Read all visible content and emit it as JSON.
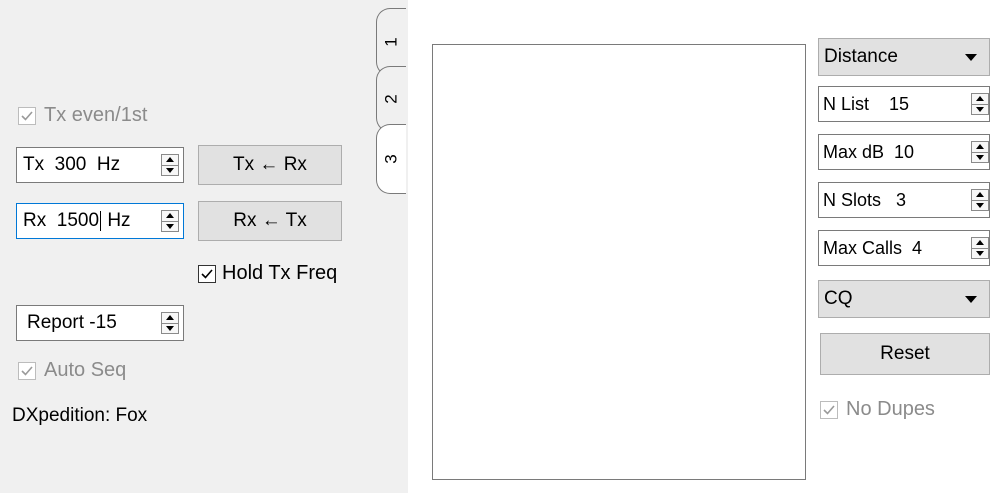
{
  "left": {
    "tx_even": {
      "label": "Tx even/1st",
      "checked": true,
      "enabled": false
    },
    "tx_freq": {
      "value": "Tx  300  Hz"
    },
    "tx_from_rx": {
      "label": "Tx ← Rx"
    },
    "rx_freq": {
      "value_before_caret": "Rx  1500",
      "value_after_caret": " Hz"
    },
    "rx_from_tx": {
      "label": "Rx ← Tx"
    },
    "hold_tx_freq": {
      "label": "Hold Tx Freq",
      "checked": true
    },
    "report": {
      "value": "Report -15"
    },
    "auto_seq": {
      "label": "Auto Seq",
      "checked": true,
      "enabled": false
    },
    "dxpedition": {
      "label": "DXpedition: Fox"
    }
  },
  "tabs": [
    {
      "label": "1",
      "active": false
    },
    {
      "label": "2",
      "active": false
    },
    {
      "label": "3",
      "active": true
    }
  ],
  "right": {
    "sort_combo": {
      "value": "Distance"
    },
    "n_list": {
      "value": "N List    15"
    },
    "max_db": {
      "value": "Max dB  10"
    },
    "n_slots": {
      "value": "N Slots   3"
    },
    "max_calls": {
      "value": "Max Calls  4"
    },
    "mode_combo": {
      "value": "CQ"
    },
    "reset": {
      "label": "Reset"
    },
    "no_dupes": {
      "label": "No Dupes",
      "checked": true,
      "enabled": false
    }
  },
  "colors": {
    "panel_bg": "#f0f0f0",
    "focus_border": "#0078d7",
    "disabled_text": "#8b8b8b"
  }
}
